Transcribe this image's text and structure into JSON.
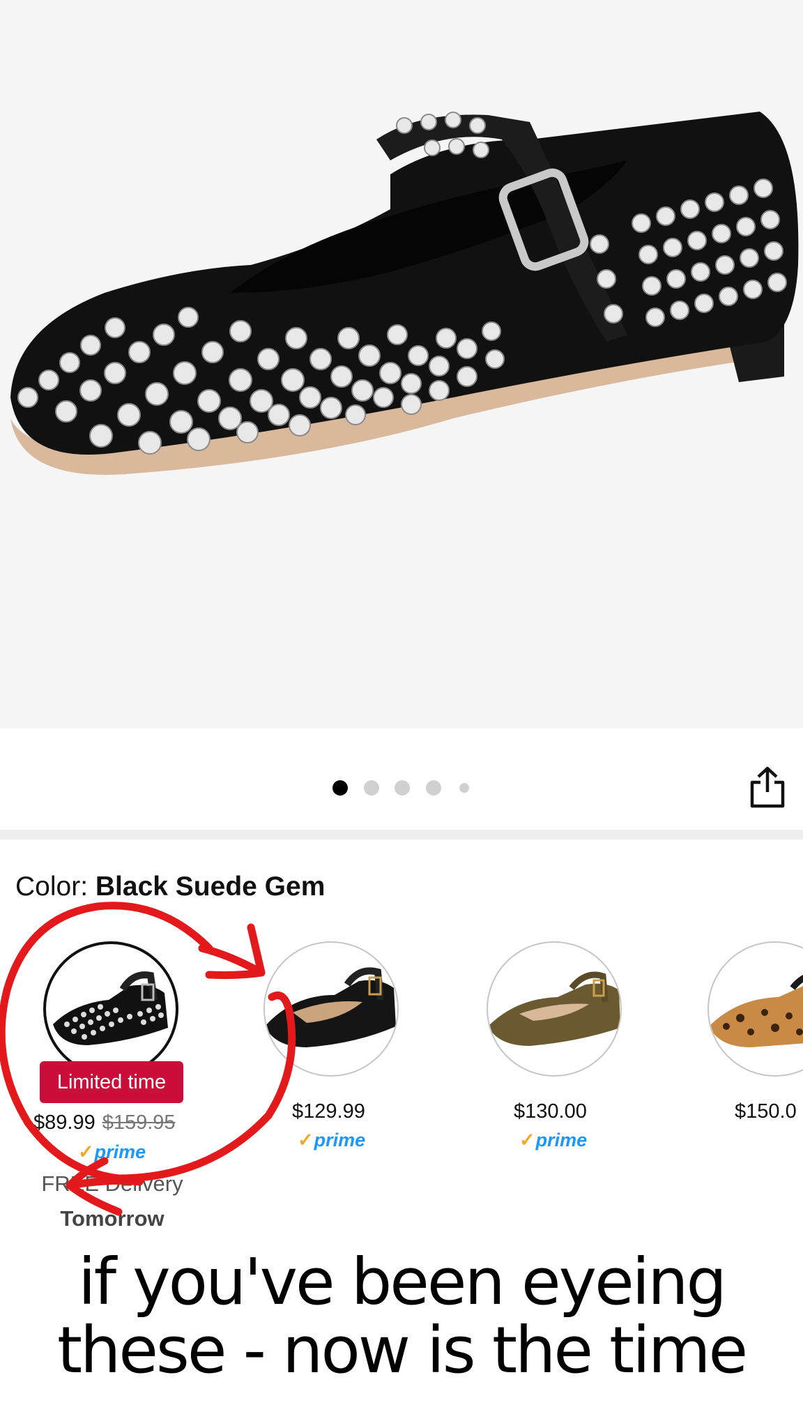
{
  "gallery": {
    "dots_total": 5,
    "active_index": 0,
    "share_icon": "share-icon"
  },
  "color": {
    "label": "Color:",
    "value": "Black Suede Gem"
  },
  "variants": [
    {
      "name": "black-suede-gem",
      "badge": "Limited time",
      "price": "$89.99",
      "list_price": "$159.95",
      "prime": "prime",
      "delivery_line1": "FREE Delivery",
      "delivery_line2": "Tomorrow",
      "selected": true
    },
    {
      "name": "black-leather",
      "price": "$129.99",
      "prime": "prime"
    },
    {
      "name": "olive-velvet",
      "price": "$130.00",
      "prime": "prime"
    },
    {
      "name": "leopard",
      "price": "$150.0"
    }
  ],
  "caption": {
    "line1": "if you've been eyeing",
    "line2": "these - now is the time"
  },
  "colors": {
    "badge_red": "#cc0c39",
    "prime_blue": "#1a98ff",
    "annotation_red": "#e3191b"
  }
}
